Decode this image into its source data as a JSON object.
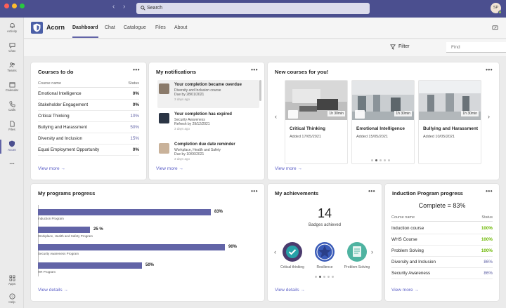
{
  "window": {
    "search_placeholder": "Search",
    "avatar_initials": "SP",
    "traffic_colors": [
      "#ff5f57",
      "#febc2e",
      "#28c840"
    ]
  },
  "rail": [
    {
      "label": "Activity",
      "icon": "bell-icon"
    },
    {
      "label": "Chat",
      "icon": "chat-icon"
    },
    {
      "label": "Teams",
      "icon": "teams-icon"
    },
    {
      "label": "Calendar",
      "icon": "calendar-icon"
    },
    {
      "label": "Calls",
      "icon": "phone-icon"
    },
    {
      "label": "Files",
      "icon": "file-icon"
    },
    {
      "label": "Acorn",
      "icon": "acorn-shield-icon",
      "active": true
    },
    {
      "label": "...",
      "icon": "more-icon"
    },
    {
      "label": "Apps",
      "icon": "apps-icon"
    },
    {
      "label": "Help",
      "icon": "help-icon"
    }
  ],
  "header": {
    "app_name": "Acorn",
    "tabs": [
      "Dashboard",
      "Chat",
      "Catalogue",
      "Files",
      "About"
    ],
    "active_tab": "Dashboard"
  },
  "toolbar": {
    "filter_label": "Filter",
    "find_placeholder": "Find"
  },
  "courses_todo": {
    "title": "Courses to do",
    "col_name": "Course name",
    "col_status": "Status",
    "rows": [
      {
        "name": "Emotional Intelligence",
        "status": "0%"
      },
      {
        "name": "Stakeholder Engagement",
        "status": "0%"
      },
      {
        "name": "Critical Thinking",
        "status": "10%"
      },
      {
        "name": "Bullying and Harassment",
        "status": "50%"
      },
      {
        "name": "Diversity and Inclusion",
        "status": "15%"
      },
      {
        "name": "Equal Employment Opportunity",
        "status": "0%"
      }
    ],
    "view_more": "View more"
  },
  "notifications": {
    "title": "My notifications",
    "items": [
      {
        "title": "Your completion became overdue",
        "line1": "Diversity and Inclusion course",
        "line2": "Due by 28/01/2021",
        "ago": "3 days ago"
      },
      {
        "title": "Your completion has expired",
        "line1": "Security Awareness",
        "line2": "Refresh by 29/12/2021",
        "ago": "3 days ago"
      },
      {
        "title": "Completion due date reminder",
        "line1": "Workplace, Health and Safety",
        "line2": "Due by 10/06/2021",
        "ago": "3 days ago"
      }
    ],
    "view_more": "View more"
  },
  "new_courses": {
    "title": "New courses for you!",
    "items": [
      {
        "name": "Critical Thinking",
        "added": "Added 17/05/2021",
        "duration": "1h 30min"
      },
      {
        "name": "Emotional Intelligence",
        "added": "Added 15/05/2021",
        "duration": "1h 30min"
      },
      {
        "name": "Bullying and Harassment",
        "added": "Added 10/05/2021",
        "duration": "1h 30min"
      }
    ],
    "view_more": "View more"
  },
  "programs": {
    "title": "My programs progress",
    "items": [
      {
        "name": "Induction Program",
        "value": 83,
        "label": "83%"
      },
      {
        "name": "Workplace, Health and Safety Program",
        "value": 25,
        "label": "25 %"
      },
      {
        "name": "Security Awareness Program",
        "value": 90,
        "label": "90%"
      },
      {
        "name": "HR Program",
        "value": 50,
        "label": "50%"
      }
    ],
    "view_details": "View details"
  },
  "achievements": {
    "title": "My achievements",
    "count": "14",
    "count_label": "Badges achieved",
    "badges": [
      {
        "name": "Critical thinking",
        "icon": "check-badge-icon"
      },
      {
        "name": "Resilience",
        "icon": "star-badge-icon"
      },
      {
        "name": "Problem Solving",
        "icon": "document-badge-icon"
      }
    ],
    "view_details": "View details"
  },
  "induction": {
    "title": "Induction Program progress",
    "complete": "Complete = 83%",
    "col_name": "Course name",
    "col_status": "Status",
    "rows": [
      {
        "name": "Induction course",
        "status": "100%",
        "color": "#6bb700"
      },
      {
        "name": "WHS Course",
        "status": "100%",
        "color": "#6bb700"
      },
      {
        "name": "Problem Solving",
        "status": "100%",
        "color": "#6bb700"
      },
      {
        "name": "Diversity and Inclusion",
        "status": "86%",
        "color": "#6264a7"
      },
      {
        "name": "Security Awareness",
        "status": "86%",
        "color": "#6264a7"
      }
    ],
    "view_more": "View more"
  },
  "colors": {
    "accent": "#6264a7",
    "titlebar": "#4b4f8f",
    "link": "#5b5fc7",
    "complete_green": "#6bb700"
  }
}
